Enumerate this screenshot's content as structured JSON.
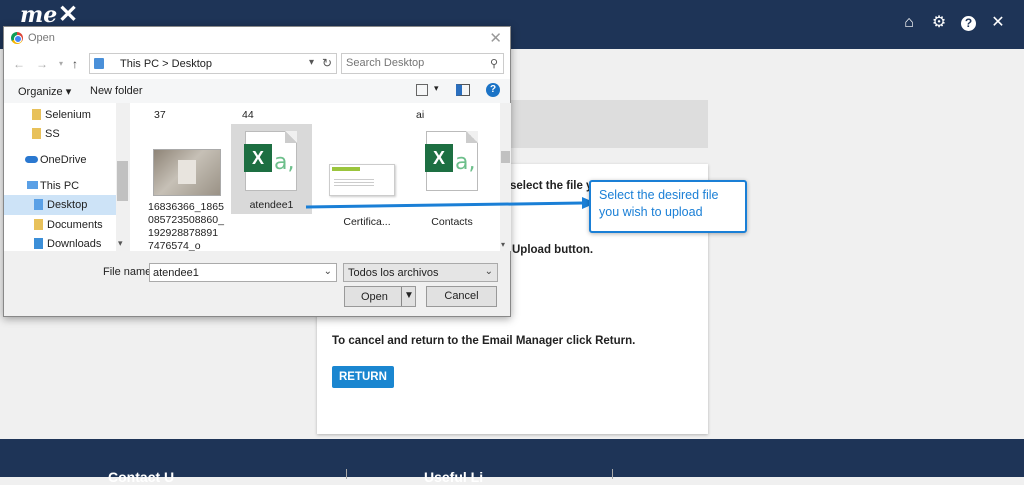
{
  "app": {
    "logo_text": "me"
  },
  "topbar": {
    "icons": [
      "home-icon",
      "gear-icon",
      "help-icon",
      "close-icon"
    ],
    "help_glyph": "?"
  },
  "card": {
    "line1": "select the file y",
    "line2": "Upload button.",
    "line3": "To cancel and return to the Email Manager click Return.",
    "return_label": "RETURN"
  },
  "footer": {
    "col1": "Contact U",
    "col2": "Useful Li"
  },
  "dialog": {
    "title": "Open",
    "path": "This PC  >  Desktop",
    "search_placeholder": "Search Desktop",
    "organize": "Organize ▾",
    "new_folder": "New folder",
    "sidebar": [
      {
        "label": "Selenium"
      },
      {
        "label": "SS"
      },
      {
        "label": "OneDrive"
      },
      {
        "label": "This PC"
      },
      {
        "label": "Desktop"
      },
      {
        "label": "Documents"
      },
      {
        "label": "Downloads"
      }
    ],
    "files_top": [
      "37",
      "44",
      "ai"
    ],
    "files": [
      {
        "name": "16836366_1865\n085723508860_\n192928878891\n7476574_o"
      },
      {
        "name": "atendee1"
      },
      {
        "name": "Certifica..."
      },
      {
        "name": "Contacts"
      }
    ],
    "filename_label": "File name:",
    "filename_value": "atendee1",
    "filetype_value": "Todos los archivos",
    "open_label": "Open",
    "cancel_label": "Cancel"
  },
  "tooltip": {
    "text": "Select the desired file you wish to upload"
  },
  "colors": {
    "navy": "#1e3457",
    "accent": "#1a86d0"
  }
}
